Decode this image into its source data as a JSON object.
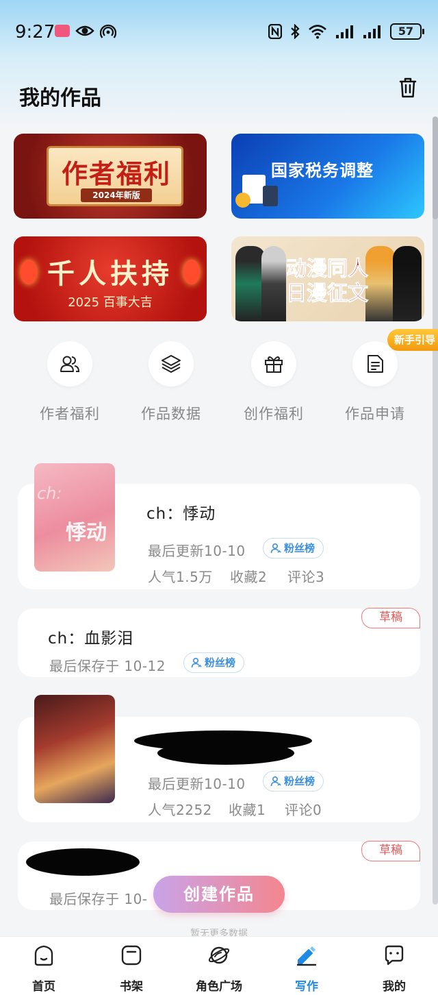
{
  "status_bar": {
    "time": "9:27",
    "battery": "57"
  },
  "header": {
    "title": "我的作品"
  },
  "banners": [
    {
      "title": "作者福利",
      "subtitle": "2024年新版"
    },
    {
      "title": "国家税务调整"
    },
    {
      "title": "千人扶持",
      "subtitle": "2025 百事大吉"
    },
    {
      "title_line1": "动漫同人",
      "title_line2": "日漫征文"
    }
  ],
  "guide_tag": "新手引导",
  "quick_actions": [
    {
      "label": "作者福利",
      "icon": "users-icon"
    },
    {
      "label": "作品数据",
      "icon": "layers-icon"
    },
    {
      "label": "创作福利",
      "icon": "gift-icon"
    },
    {
      "label": "作品申请",
      "icon": "document-icon"
    }
  ],
  "works": [
    {
      "title": "ch：悸动",
      "cover_text": "悸动",
      "cover_text2": "ch:",
      "updated": "最后更新10-10",
      "fan_badge": "粉丝榜",
      "popularity": "人气1.5万",
      "favorites": "收藏2",
      "comments": "评论3"
    },
    {
      "title": "ch：血影泪",
      "saved": "最后保存于 10-12",
      "fan_badge": "粉丝榜",
      "draft_label": "草稿"
    },
    {
      "updated": "最后更新10-10",
      "fan_badge": "粉丝榜",
      "popularity": "人气2252",
      "favorites": "收藏1",
      "comments": "评论0"
    },
    {
      "saved": "最后保存于 10-",
      "draft_label": "草稿"
    }
  ],
  "create_button": "创建作品",
  "no_more": "暂无更多数据",
  "bottom_nav": [
    {
      "label": "首页",
      "icon": "home-icon"
    },
    {
      "label": "书架",
      "icon": "bookshelf-icon"
    },
    {
      "label": "角色广场",
      "icon": "planet-icon"
    },
    {
      "label": "写作",
      "icon": "pen-icon",
      "active": true
    },
    {
      "label": "我的",
      "icon": "chat-icon"
    }
  ],
  "colors": {
    "accent": "#1f8ae6",
    "draft": "#e05a5a",
    "create_start": "#c9a3e9",
    "create_end": "#f3868f"
  }
}
